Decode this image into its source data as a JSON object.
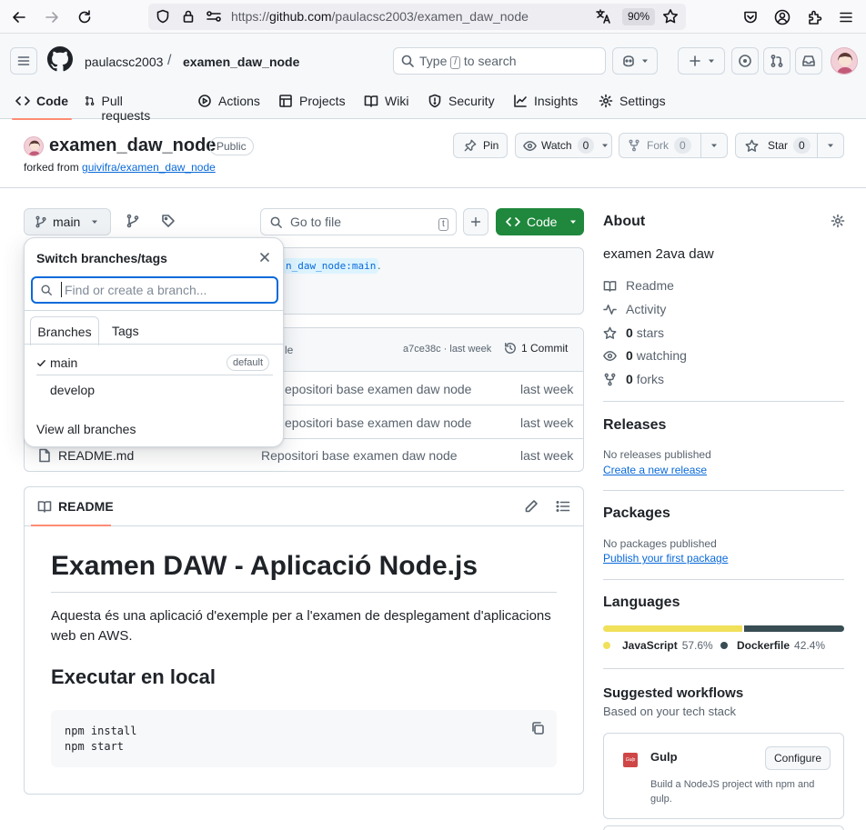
{
  "browser": {
    "url_prefix": "https://",
    "url_host": "github.com",
    "url_path": "/paulacsc2003/examen_daw_node",
    "zoom": "90%"
  },
  "header": {
    "owner": "paulacsc2003",
    "separator": "/",
    "repo": "examen_daw_node",
    "search_prefix": "Type",
    "search_key": "/",
    "search_suffix": "to search"
  },
  "tabs": [
    {
      "label": "Code",
      "icon": "code-icon"
    },
    {
      "label": "Pull requests",
      "icon": "pull-request-icon"
    },
    {
      "label": "Actions",
      "icon": "play-icon"
    },
    {
      "label": "Projects",
      "icon": "table-icon"
    },
    {
      "label": "Wiki",
      "icon": "book-icon"
    },
    {
      "label": "Security",
      "icon": "shield-icon"
    },
    {
      "label": "Insights",
      "icon": "graph-icon"
    },
    {
      "label": "Settings",
      "icon": "gear-icon"
    }
  ],
  "repo": {
    "name": "examen_daw_node",
    "visibility": "Public",
    "forked_prefix": "forked from",
    "forked_link": "guivifra/examen_daw_node",
    "pin": "Pin",
    "watch": "Watch",
    "watch_count": "0",
    "fork": "Fork",
    "fork_count": "0",
    "star": "Star",
    "star_count": "0"
  },
  "toolbar": {
    "branch": "main",
    "go_to_file": "Go to file",
    "go_to_file_key": "t",
    "code_button": "Code"
  },
  "sync_banner": {
    "ref": "n_daw_node:main",
    "suffix": "."
  },
  "commit_header": {
    "partial_label": "le",
    "hash": "a7ce38c",
    "time": "· last week",
    "commits": "1 Commit"
  },
  "files": [
    {
      "name": "",
      "message": "epositori base examen daw node",
      "time": "last week"
    },
    {
      "name": "",
      "message": "epositori base examen daw node",
      "time": "last week"
    },
    {
      "name": "README.md",
      "message": "Repositori base examen daw node",
      "time": "last week"
    }
  ],
  "branch_panel": {
    "title": "Switch branches/tags",
    "placeholder": "Find or create a branch...",
    "tab_branches": "Branches",
    "tab_tags": "Tags",
    "branches": [
      {
        "name": "main",
        "checked": true,
        "badge": "default"
      },
      {
        "name": "develop",
        "checked": false,
        "badge": ""
      }
    ],
    "view_all": "View all branches"
  },
  "readme": {
    "tab_label": "README",
    "h1": "Examen DAW - Aplicació Node.js",
    "paragraph": "Aquesta és una aplicació d'exemple per a l'examen de desplegament d'aplicacions web en AWS.",
    "h2": "Executar en local",
    "code_line1": "npm install",
    "code_line2": "npm start"
  },
  "about": {
    "title": "About",
    "description": "examen 2ava daw",
    "readme": "Readme",
    "activity": "Activity",
    "stars_count": "0",
    "stars_label": "stars",
    "watching_count": "0",
    "watching_label": "watching",
    "forks_count": "0",
    "forks_label": "forks"
  },
  "releases": {
    "title": "Releases",
    "none": "No releases published",
    "link": "Create a new release"
  },
  "packages": {
    "title": "Packages",
    "none": "No packages published",
    "link": "Publish your first package"
  },
  "languages": {
    "title": "Languages",
    "items": [
      {
        "name": "JavaScript",
        "percent": 57.6,
        "percent_label": "57.6%",
        "color": "#f1e05a"
      },
      {
        "name": "Dockerfile",
        "percent": 42.4,
        "percent_label": "42.4%",
        "color": "#384d54"
      }
    ]
  },
  "workflows": {
    "title": "Suggested workflows",
    "subtitle": "Based on your tech stack",
    "card_name": "Gulp",
    "card_logo_text": "Gulp",
    "card_button": "Configure",
    "card_desc": "Build a NodeJS project with npm and gulp."
  },
  "colors": {
    "accent_tab": "#fd8c73",
    "green_button": "#1f883d",
    "link": "#0969da"
  }
}
